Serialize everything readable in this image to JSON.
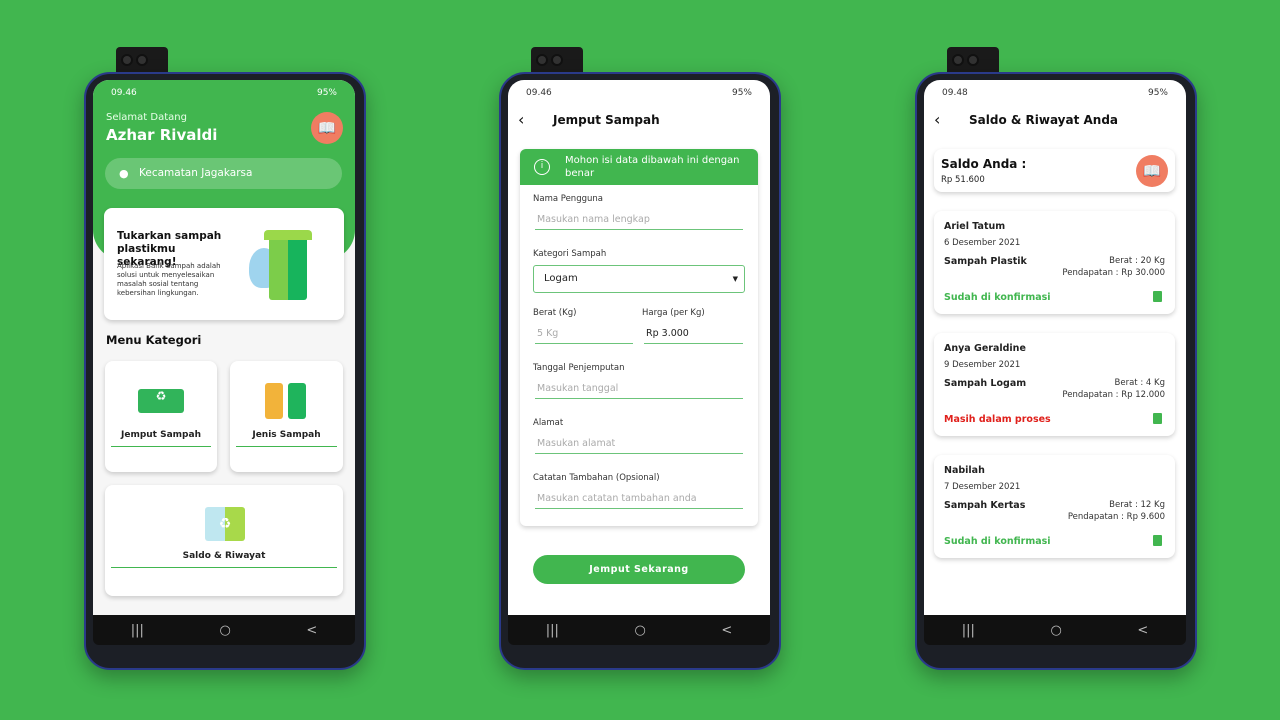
{
  "phone1": {
    "status": {
      "time": "09.46",
      "icons": "wifi signal",
      "battery": "95%"
    },
    "greeting": "Selamat Datang",
    "user_name": "Azhar Rivaldi",
    "location": "Kecamatan Jagakarsa",
    "banner": {
      "title": "Tukarkan sampah plastikmu sekarang!",
      "description": "Aplikasi Bank Sampah adalah solusi untuk menyelesaikan masalah sosial tentang kebersihan lingkungan."
    },
    "menu_title": "Menu Kategori",
    "menu": [
      {
        "label": "Jemput Sampah",
        "icon": "truck-icon"
      },
      {
        "label": "Jenis Sampah",
        "icon": "bins-icon"
      },
      {
        "label": "Saldo & Riwayat",
        "icon": "recycle-bin-icon"
      }
    ]
  },
  "phone2": {
    "status": {
      "time": "09.46",
      "battery": "95%"
    },
    "title": "Jemput Sampah",
    "notice": "Mohon isi data dibawah ini dengan benar",
    "fields": {
      "nama_label": "Nama Pengguna",
      "nama_placeholder": "Masukan nama lengkap",
      "kategori_label": "Kategori Sampah",
      "kategori_value": "Logam",
      "berat_label": "Berat (Kg)",
      "berat_placeholder": "5 Kg",
      "harga_label": "Harga (per Kg)",
      "harga_value": "Rp 3.000",
      "tanggal_label": "Tanggal Penjemputan",
      "tanggal_placeholder": "Masukan tanggal",
      "alamat_label": "Alamat",
      "alamat_placeholder": "Masukan alamat",
      "catatan_label": "Catatan Tambahan (Opsional)",
      "catatan_placeholder": "Masukan catatan tambahan anda"
    },
    "submit": "Jemput Sekarang"
  },
  "phone3": {
    "status": {
      "time": "09.48",
      "battery": "95%"
    },
    "title": "Saldo & Riwayat Anda",
    "saldo_label": "Saldo Anda :",
    "saldo_value": "Rp 51.600",
    "history": [
      {
        "name": "Ariel Tatum",
        "date": "6 Desember 2021",
        "type": "Sampah Plastik",
        "weight": "Berat : 20 Kg",
        "income": "Pendapatan : Rp 30.000",
        "status": "Sudah di konfirmasi",
        "status_color": "#41b64f"
      },
      {
        "name": "Anya Geraldine",
        "date": "9 Desember 2021",
        "type": "Sampah Logam",
        "weight": "Berat : 4 Kg",
        "income": "Pendapatan : Rp 12.000",
        "status": "Masih dalam proses",
        "status_color": "#e0201b"
      },
      {
        "name": "Nabilah",
        "date": "7 Desember 2021",
        "type": "Sampah Kertas",
        "weight": "Berat : 12 Kg",
        "income": "Pendapatan : Rp 9.600",
        "status": "Sudah di konfirmasi",
        "status_color": "#41b64f"
      }
    ]
  },
  "nav": {
    "recents": "|||",
    "home": "○",
    "back": "<"
  },
  "colors": {
    "accent": "#41b64f",
    "danger": "#e0201b"
  }
}
